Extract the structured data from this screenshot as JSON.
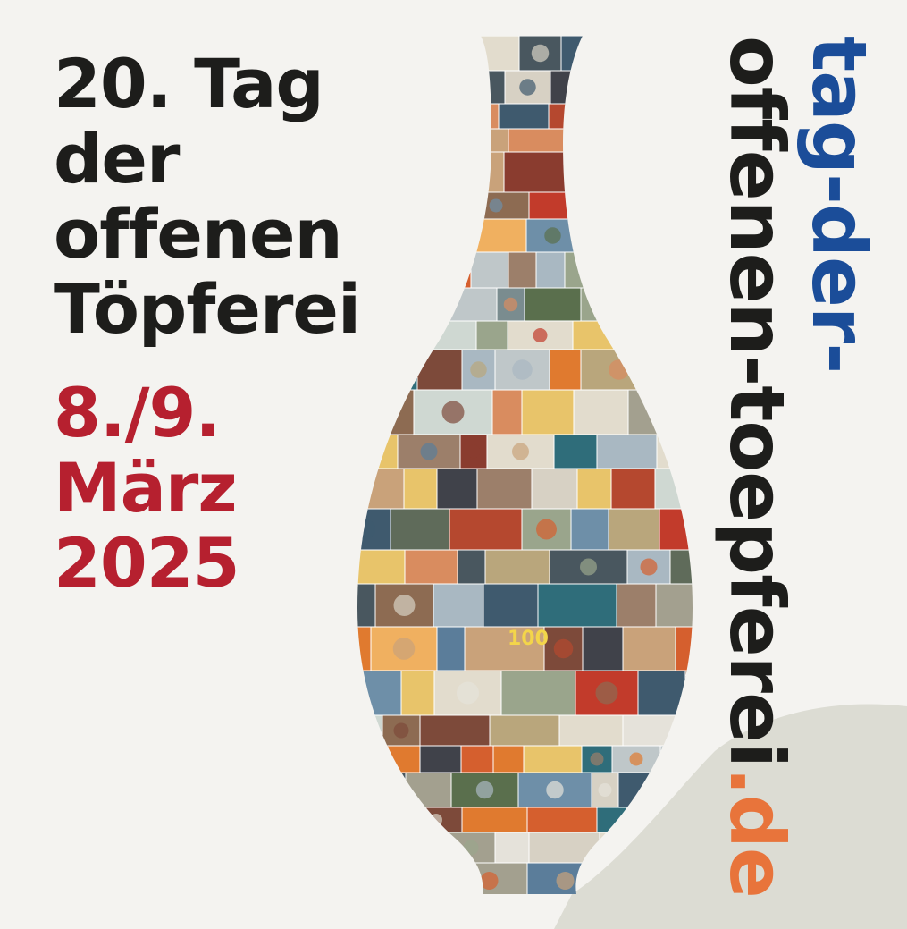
{
  "title_lines": [
    "20. Tag",
    "der",
    "offenen",
    "Töpferei"
  ],
  "date_lines": [
    "8./9.",
    "März",
    "2025"
  ],
  "url": {
    "line1": "tag-der-",
    "line2_part1": "offenen-toepferei",
    "line2_part2": ".de"
  },
  "colors": {
    "background": "#f4f3f0",
    "title": "#1d1d1b",
    "date": "#b6202f",
    "url_blue": "#1b4d99",
    "url_orange": "#e8743b",
    "url_dark": "#1d1d1b",
    "shadow": "#dcdcd3"
  },
  "image": {
    "subject": "vase-mosaic",
    "overlay_text": "100"
  }
}
